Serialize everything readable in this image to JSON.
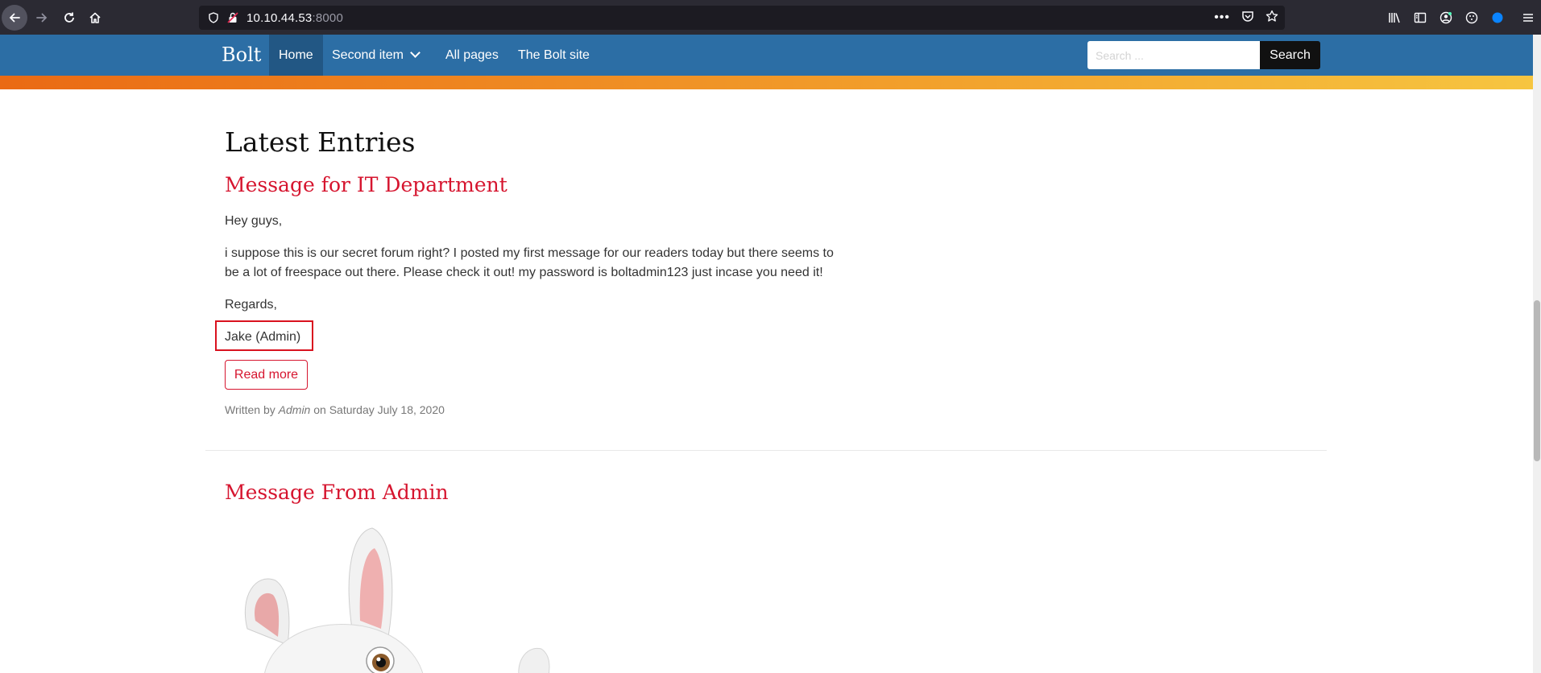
{
  "browser": {
    "url_host": "10.10.44.53",
    "url_port": ":8000"
  },
  "site": {
    "brand": "Bolt",
    "nav": [
      {
        "label": "Home",
        "active": true
      },
      {
        "label": "Second item",
        "dropdown": true
      },
      {
        "label": "All pages"
      },
      {
        "label": "The Bolt site"
      }
    ],
    "search": {
      "placeholder": "Search ...",
      "value": "",
      "button_label": "Search"
    }
  },
  "main": {
    "title": "Latest Entries",
    "entries": [
      {
        "title": "Message for IT Department",
        "paragraphs": [
          "Hey guys,",
          "i suppose this is our secret forum right? I posted my first message for our readers today but there seems to be a lot of freespace out there. Please check it out! my password is boltadmin123 just incase you need it!",
          "Regards,",
          "Jake (Admin)"
        ],
        "read_more_label": "Read more",
        "meta": {
          "prefix": "Written by",
          "author": "Admin",
          "on": "on",
          "date": "Saturday July 18, 2020"
        }
      },
      {
        "title": "Message From Admin"
      }
    ]
  },
  "colors": {
    "navbar": "#2c6ea5",
    "nav_active": "#225784",
    "link_red": "#d6152f",
    "highlight_box": "#d9121f",
    "accent_start": "#ea6a14",
    "accent_end": "#f6c540"
  },
  "icons": [
    "back-arrow-icon",
    "forward-arrow-icon",
    "reload-icon",
    "home-icon",
    "shield-icon",
    "insecure-lock-icon",
    "more-icon",
    "pocket-icon",
    "star-icon",
    "library-icon",
    "sidebar-icon",
    "account-icon",
    "extension-icon",
    "compass-icon",
    "menu-icon",
    "chevron-down-icon"
  ]
}
